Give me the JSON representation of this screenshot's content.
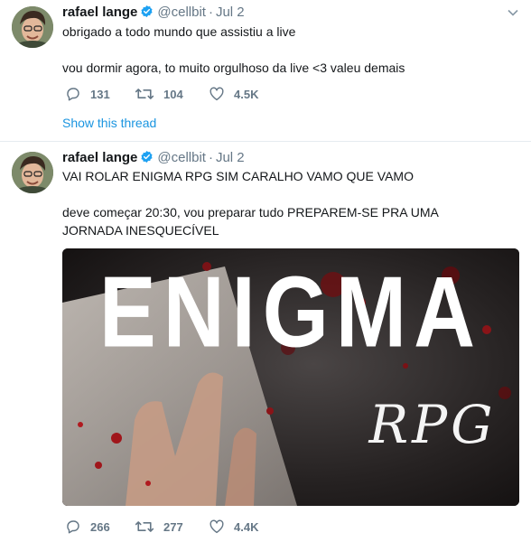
{
  "tweets": [
    {
      "name": "rafael lange",
      "handle": "@cellbit",
      "separator": "·",
      "time": "Jul 2",
      "text_lines": [
        "obrigado a todo mundo que assistiu a live",
        "vou dormir agora, to muito orgulhoso da live <3 valeu demais"
      ],
      "replies": "131",
      "retweets": "104",
      "likes": "4.5K",
      "thread_link": "Show this thread"
    },
    {
      "name": "rafael lange",
      "handle": "@cellbit",
      "separator": "·",
      "time": "Jul 2",
      "text_lines": [
        "VAI ROLAR ENIGMA RPG SIM CARALHO VAMO QUE VAMO",
        "deve começar 20:30, vou preparar tudo PREPAREM-SE PRA UMA JORNADA INESQUECÍVEL"
      ],
      "media": {
        "title": "ENIGMA",
        "subtitle": "RPG"
      },
      "replies": "266",
      "retweets": "277",
      "likes": "4.4K"
    }
  ],
  "colors": {
    "text": "#14171a",
    "secondary": "#657786",
    "link": "#1b95e0",
    "verified": "#1da1f2",
    "divider": "#e6ecf0"
  },
  "icons": [
    "verified-badge-icon",
    "caret-down-icon",
    "reply-icon",
    "retweet-icon",
    "like-icon"
  ]
}
